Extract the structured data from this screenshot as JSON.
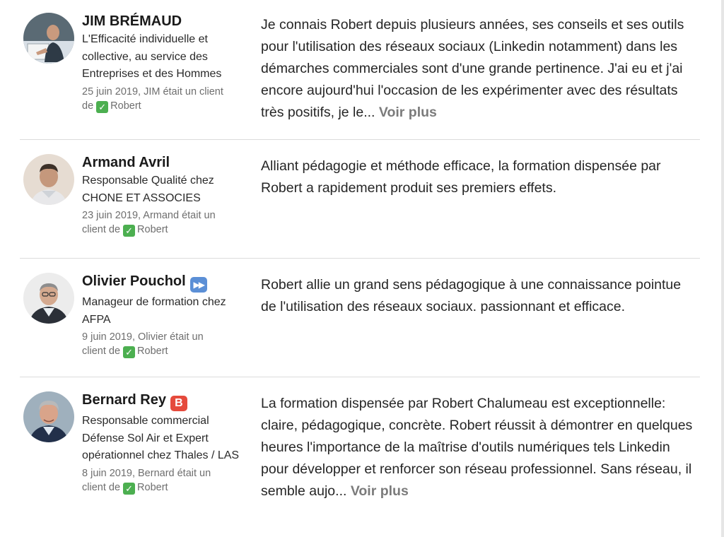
{
  "recommendations": [
    {
      "name": "JIM BRÉMAUD",
      "badge": "",
      "headline": "L'Efficacité individuelle et collective, au service des Entreprises et des Hommes",
      "date_line": "25 juin 2019, JIM était un client",
      "client_prefix": "de",
      "client_name": "Robert",
      "text": "Je connais Robert depuis plusieurs années, ses conseils et ses outils pour l'utilisation des réseaux sociaux (Linkedin notamment) dans les démarches commerciales sont d'une grande pertinence. J'ai eu et j'ai encore aujourd'hui l'occasion de les expérimenter avec des résultats très positifs, je le...",
      "more": "Voir plus"
    },
    {
      "name": "Armand Avril",
      "badge": "",
      "headline": "Responsable Qualité chez CHONE ET ASSOCIES",
      "date_line": "23 juin 2019, Armand était un",
      "client_prefix": "client de",
      "client_name": "Robert",
      "text": "Alliant pédagogie et méthode efficace, la formation dispensée par Robert a rapidement produit ses premiers effets.",
      "more": ""
    },
    {
      "name": "Olivier Pouchol",
      "badge": "⏩",
      "headline": "Manageur de formation chez AFPA",
      "date_line": "9 juin 2019, Olivier était un",
      "client_prefix": "client de",
      "client_name": "Robert",
      "text": "Robert allie un grand sens pédagogique à une connaissance pointue de l'utilisation des réseaux sociaux. passionnant et efficace.",
      "more": ""
    },
    {
      "name": "Bernard Rey",
      "badge": "B",
      "headline": "Responsable commercial Défense Sol Air et Expert opérationnel chez Thales / LAS",
      "date_line": "8 juin 2019, Bernard était un",
      "client_prefix": "client de",
      "client_name": "Robert",
      "text": "La formation dispensée par Robert Chalumeau est exceptionnelle: claire, pédagogique, concrète. Robert réussit à démontrer en quelques heures l'importance de la maîtrise d'outils numériques tels Linkedin pour développer et renforcer son réseau professionnel. Sans réseau, il semble aujo...",
      "more": "Voir plus"
    }
  ],
  "colors": {
    "more_link": "#7b7b7b",
    "divider": "#dcdcdc",
    "check_badge": "#4caf50",
    "badge_fastforward": "#5b8fd6",
    "badge_b": "#e54a3c"
  },
  "icons": {
    "client_check": "check-mark-icon",
    "olivier_badge": "fast-forward-icon",
    "bernard_badge": "letter-b-icon"
  }
}
